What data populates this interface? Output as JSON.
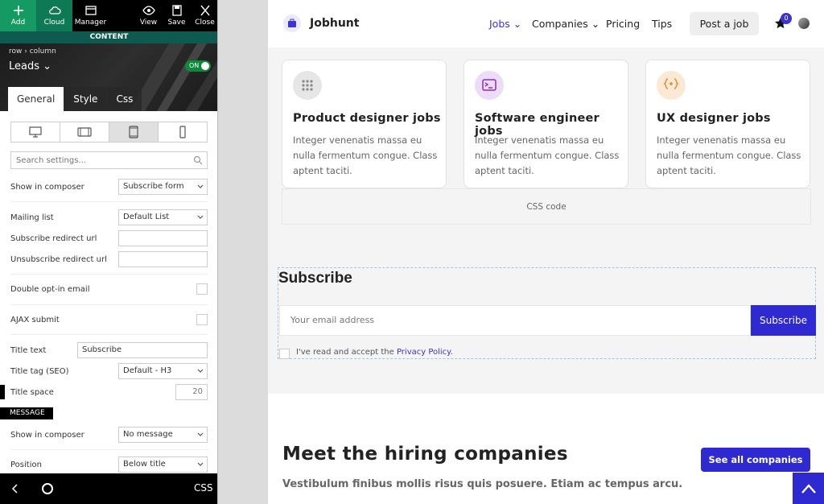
{
  "toolbar": {
    "add": "Add",
    "cloud": "Cloud",
    "manager": "Manager",
    "view": "View",
    "save": "Save",
    "close": "Close"
  },
  "panel": {
    "content_label": "CONTENT",
    "breadcrumb": "row › column",
    "element_name": "Leads",
    "toggle": "ON",
    "tabs": [
      "General",
      "Style",
      "Css"
    ],
    "search_placeholder": "Search settings...",
    "fields": {
      "show_in_composer": {
        "label": "Show in composer",
        "value": "Subscribe form"
      },
      "mailing_list": {
        "label": "Mailing list",
        "value": "Default List"
      },
      "subscribe_redirect": {
        "label": "Subscribe redirect url",
        "value": ""
      },
      "unsubscribe_redirect": {
        "label": "Unsubscribe redirect url",
        "value": ""
      },
      "double_optin": {
        "label": "Double opt-in email"
      },
      "ajax_submit": {
        "label": "AJAX submit"
      },
      "title_text": {
        "label": "Title text",
        "value": "Subscribe"
      },
      "title_tag": {
        "label": "Title tag (SEO)",
        "value": "Default - H3"
      },
      "title_space": {
        "label": "Title space",
        "value": "20"
      },
      "message_header": "MESSAGE",
      "msg_show_in_composer": {
        "label": "Show in composer",
        "value": "No message"
      },
      "position": {
        "label": "Position",
        "value": "Below title"
      }
    },
    "bottom_css": "CSS"
  },
  "site": {
    "logo": "Jobhunt",
    "nav": {
      "jobs": "Jobs",
      "companies": "Companies",
      "pricing": "Pricing",
      "tips": "Tips"
    },
    "post_job": "Post a job",
    "badge_count": "0",
    "cards": [
      {
        "title": "Product designer jobs",
        "desc": "Integer venenatis massa eu nulla fermentum congue. Class aptent taciti."
      },
      {
        "title": "Software engineer jobs",
        "desc": "Integer venenatis massa eu nulla fermentum congue. Class aptent taciti."
      },
      {
        "title": "UX designer jobs",
        "desc": "Integer venenatis massa eu nulla fermentum congue. Class aptent taciti."
      }
    ],
    "css_code": "CSS code",
    "subscribe": {
      "title": "Subscribe",
      "placeholder": "Your email address",
      "button": "Subscribe",
      "agree_prefix": "I've read and accept the ",
      "privacy_link": "Privacy Policy",
      "agree_suffix": "."
    },
    "companies": {
      "title": "Meet the hiring companies",
      "subtitle": "Vestibulum finibus mollis risus quis posuere. Etiam ac tempus arcu.",
      "see_all": "See all companies"
    }
  },
  "colors": {
    "accent": "#2e29d0",
    "toolbar_green": "#159a64",
    "toggle_green": "#0a8a3a"
  }
}
